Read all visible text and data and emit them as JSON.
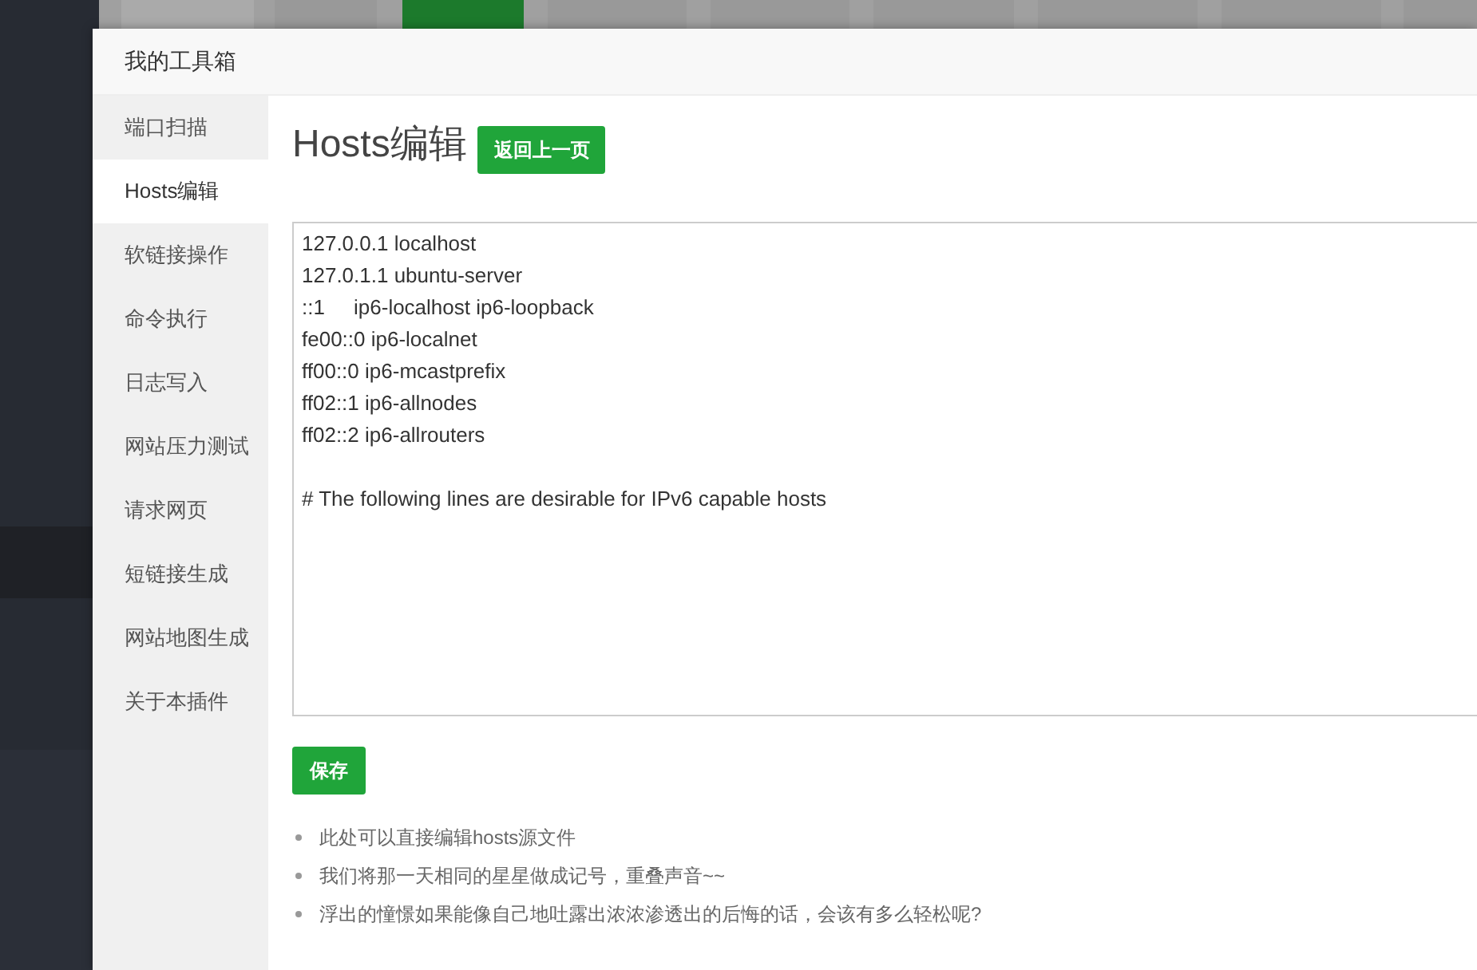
{
  "background_tabs": [
    {
      "selected": false
    },
    {
      "selected": false
    },
    {
      "selected": true
    },
    {
      "selected": false
    },
    {
      "selected": false
    },
    {
      "selected": false
    },
    {
      "selected": false
    },
    {
      "selected": false
    },
    {
      "selected": false
    }
  ],
  "dialog": {
    "title": "我的工具箱"
  },
  "sidebar": {
    "items": [
      {
        "label": "端口扫描",
        "selected": false
      },
      {
        "label": "Hosts编辑",
        "selected": true
      },
      {
        "label": "软链接操作",
        "selected": false
      },
      {
        "label": "命令执行",
        "selected": false
      },
      {
        "label": "日志写入",
        "selected": false
      },
      {
        "label": "网站压力测试",
        "selected": false
      },
      {
        "label": "请求网页",
        "selected": false
      },
      {
        "label": "短链接生成",
        "selected": false
      },
      {
        "label": "网站地图生成",
        "selected": false
      },
      {
        "label": "关于本插件",
        "selected": false
      }
    ]
  },
  "content": {
    "title": "Hosts编辑",
    "back_button": "返回上一页",
    "editor": {
      "value": "127.0.0.1 localhost\n127.0.1.1 ubuntu-server\n::1     ip6-localhost ip6-loopback\nfe00::0 ip6-localnet\nff00::0 ip6-mcastprefix\nff02::1 ip6-allnodes\nff02::2 ip6-allrouters\n\n# The following lines are desirable for IPv6 capable hosts"
    },
    "save_button": "保存",
    "notes": [
      "此处可以直接编辑hosts源文件",
      "我们将那一天相同的星星做成记号，重叠声音~~",
      "浮出的憧憬如果能像自己地吐露出浓浓渗透出的后悔的话，会该有多么轻松呢?"
    ]
  }
}
